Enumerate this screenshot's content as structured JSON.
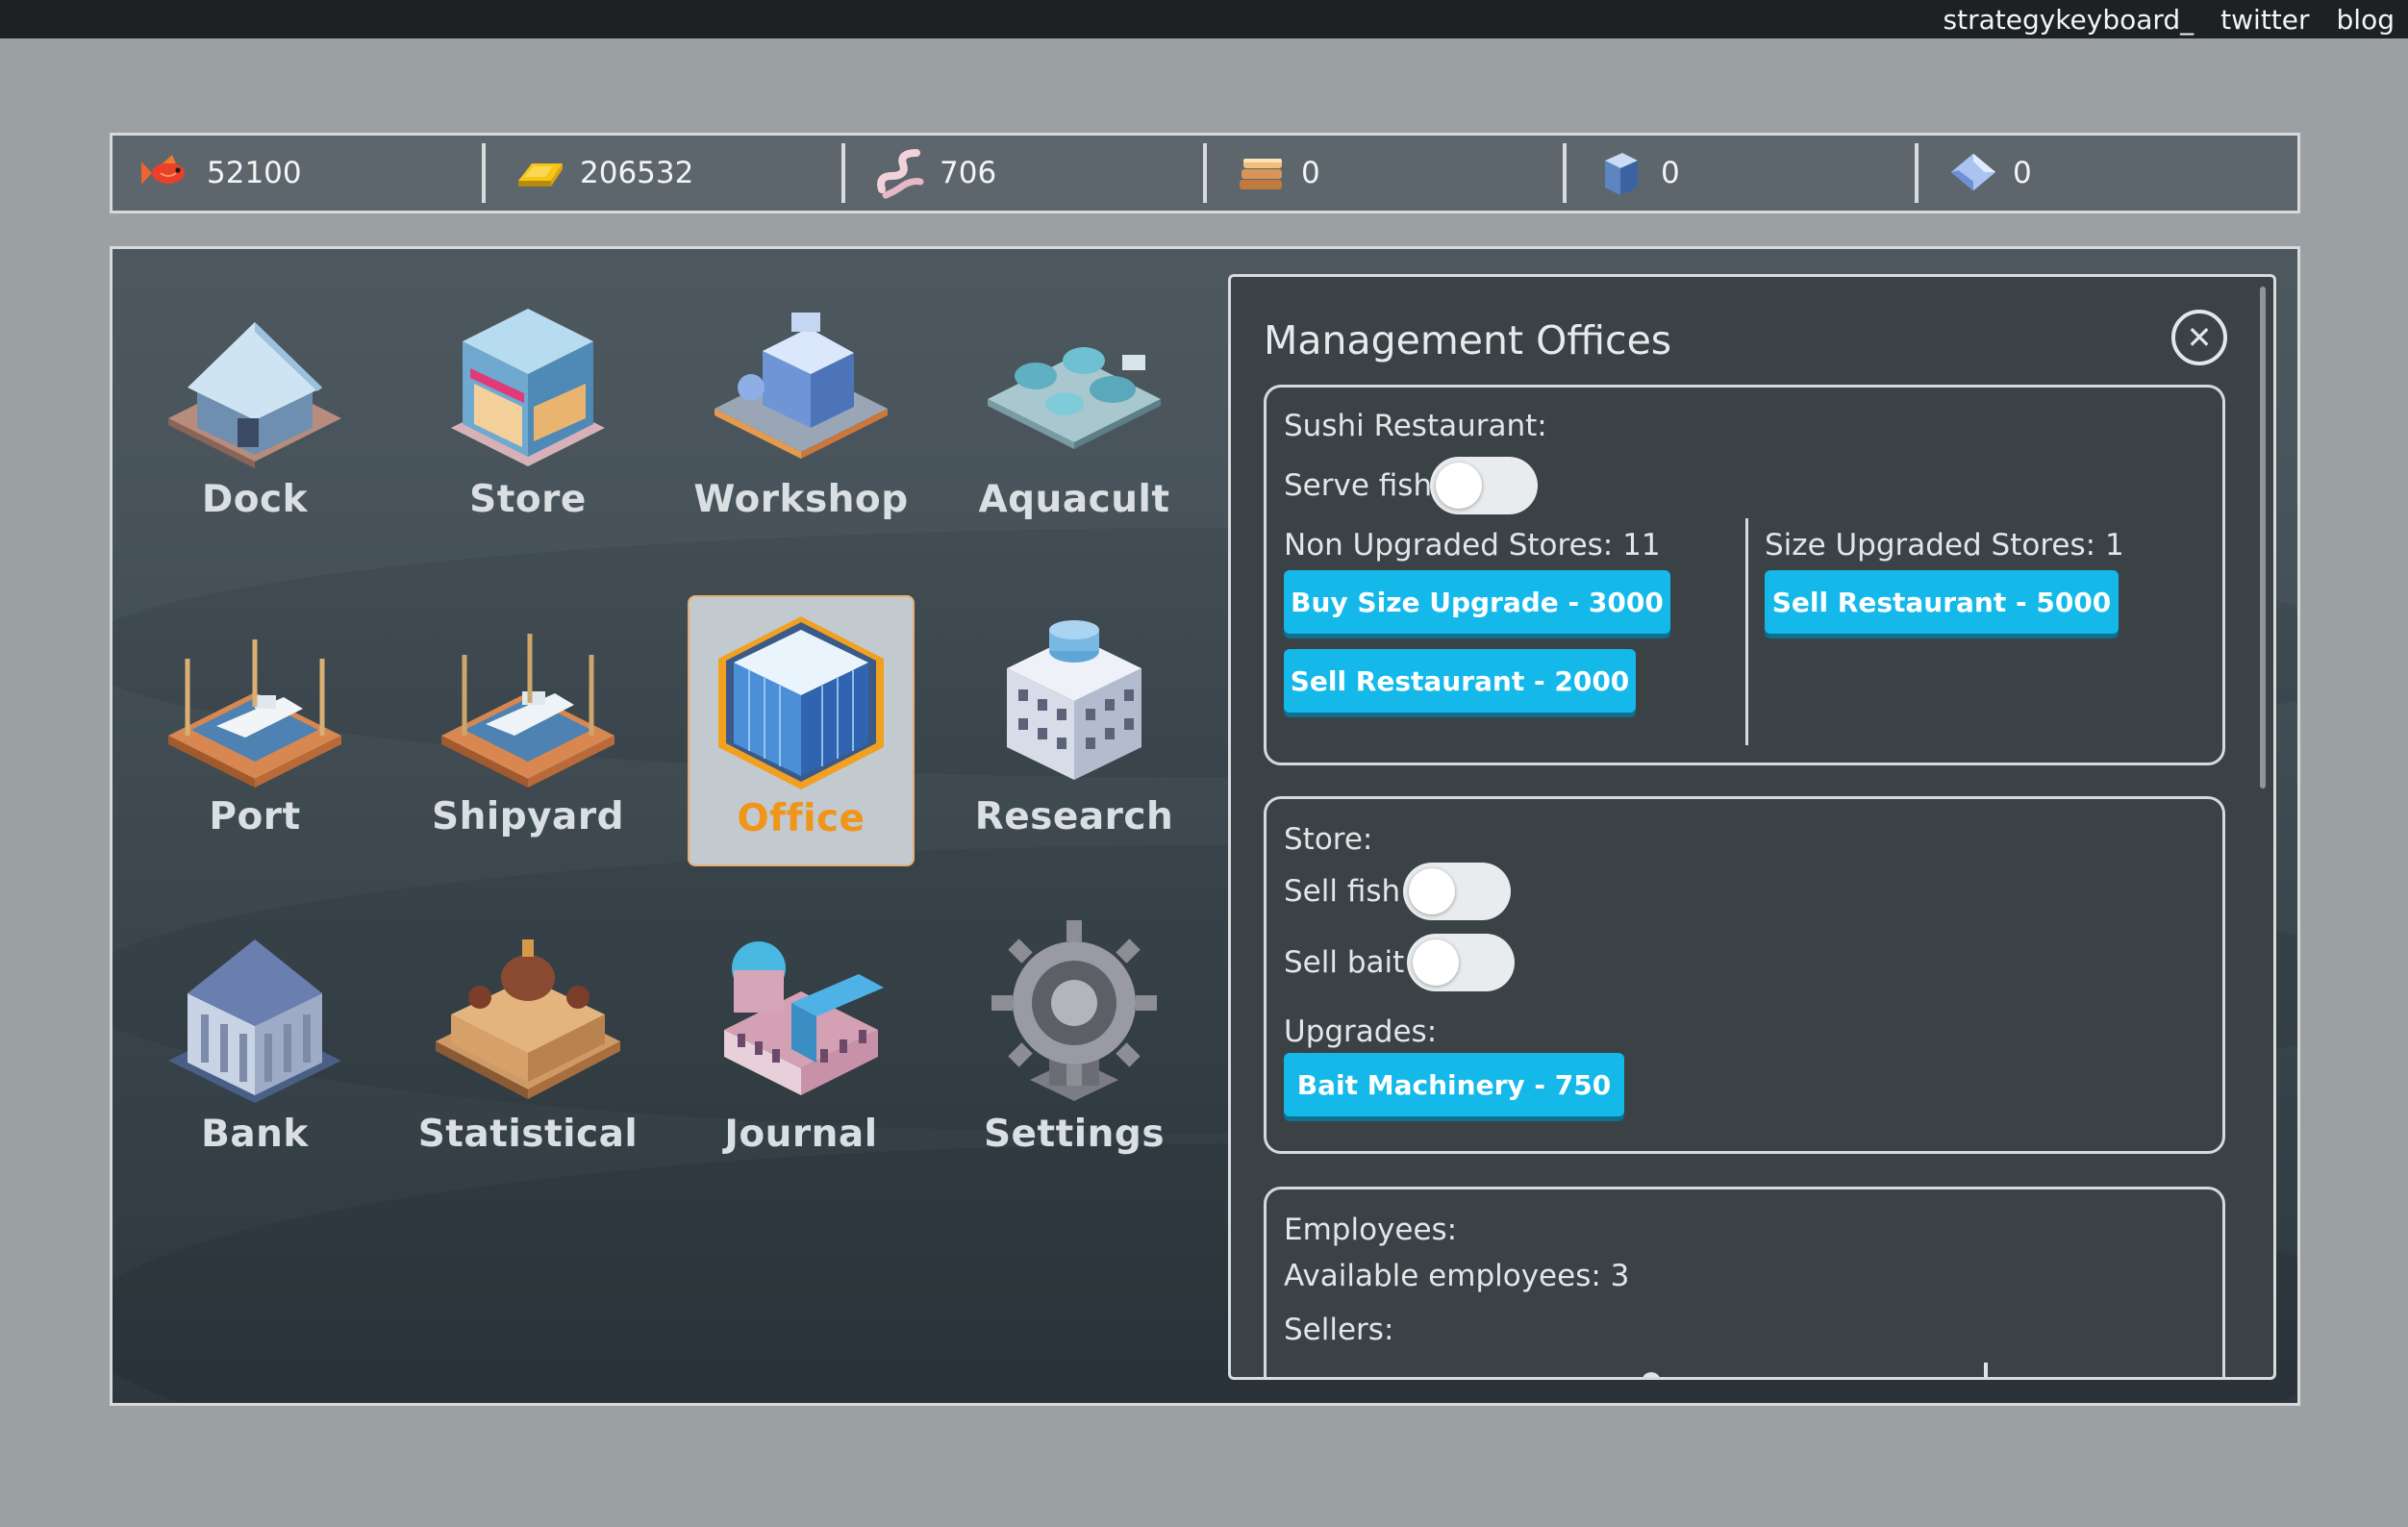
{
  "topbar": {
    "links": [
      "strategykeyboard_",
      "twitter",
      "blog"
    ]
  },
  "resources": [
    {
      "icon": "fish-icon",
      "value": "52100"
    },
    {
      "icon": "gold-bar-icon",
      "value": "206532"
    },
    {
      "icon": "worm-bait-icon",
      "value": "706"
    },
    {
      "icon": "planks-icon",
      "value": "0"
    },
    {
      "icon": "blue-block-icon",
      "value": "0"
    },
    {
      "icon": "crystal-icon",
      "value": "0"
    }
  ],
  "buildings": [
    {
      "id": "dock",
      "label": "Dock"
    },
    {
      "id": "store",
      "label": "Store"
    },
    {
      "id": "workshop",
      "label": "Workshop"
    },
    {
      "id": "aquacult",
      "label": "Aquacult"
    },
    {
      "id": "port",
      "label": "Port"
    },
    {
      "id": "shipyard",
      "label": "Shipyard"
    },
    {
      "id": "office",
      "label": "Office",
      "selected": true
    },
    {
      "id": "research",
      "label": "Research"
    },
    {
      "id": "bank",
      "label": "Bank"
    },
    {
      "id": "statistical",
      "label": "Statistical"
    },
    {
      "id": "journal",
      "label": "Journal"
    },
    {
      "id": "settings",
      "label": "Settings"
    }
  ],
  "panel": {
    "title": "Management Offices",
    "sushi": {
      "heading": "Sushi Restaurant:",
      "serve_fish_label": "Serve fish",
      "serve_fish_on": false,
      "non_upgraded_label": "Non Upgraded Stores: 11",
      "buy_upgrade_button": "Buy Size Upgrade - 3000",
      "sell_restaurant_small_button": "Sell Restaurant - 2000",
      "upgraded_label": "Size Upgraded Stores: 1",
      "sell_restaurant_large_button": "Sell Restaurant - 5000"
    },
    "store": {
      "heading": "Store:",
      "sell_fish_label": "Sell fish",
      "sell_fish_on": false,
      "sell_bait_label": "Sell bait",
      "sell_bait_on": false,
      "upgrades_label": "Upgrades:",
      "bait_machinery_button": "Bait Machinery - 750"
    },
    "employees": {
      "heading": "Employees:",
      "available_label": "Available employees: 3",
      "sellers_label": "Sellers:"
    }
  },
  "colors": {
    "accent_button": "#14b9ea",
    "selected_label": "#f09518",
    "panel_bg": "#3a4246"
  }
}
